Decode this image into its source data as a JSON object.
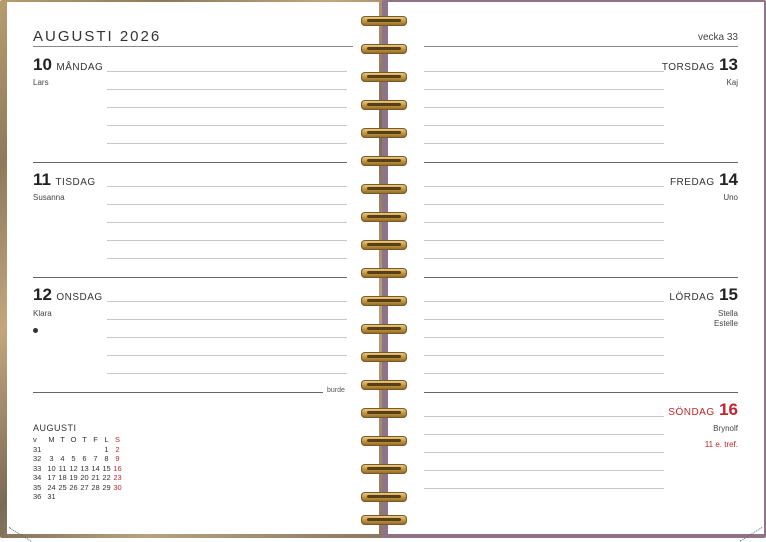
{
  "left_page": {
    "month_title": "AUGUSTI 2026",
    "days": [
      {
        "num": "10",
        "name": "MÅNDAG",
        "name_day": "Lars"
      },
      {
        "num": "11",
        "name": "TISDAG",
        "name_day": "Susanna"
      },
      {
        "num": "12",
        "name": "ONSDAG",
        "name_day": "Klara"
      }
    ],
    "brand": "burde",
    "mini_calendar": {
      "title": "AUGUSTI",
      "headers": [
        "v",
        "M",
        "T",
        "O",
        "T",
        "F",
        "L",
        "S"
      ],
      "rows": [
        [
          "31",
          "",
          "",
          "",
          "",
          "",
          "1",
          "2"
        ],
        [
          "32",
          "3",
          "4",
          "5",
          "6",
          "7",
          "8",
          "9"
        ],
        [
          "33",
          "10",
          "11",
          "12",
          "13",
          "14",
          "15",
          "16"
        ],
        [
          "34",
          "17",
          "18",
          "19",
          "20",
          "21",
          "22",
          "23"
        ],
        [
          "35",
          "24",
          "25",
          "26",
          "27",
          "28",
          "29",
          "30"
        ],
        [
          "36",
          "31",
          "",
          "",
          "",
          "",
          "",
          ""
        ]
      ]
    }
  },
  "right_page": {
    "week_label": "vecka 33",
    "days": [
      {
        "num": "13",
        "name": "TORSDAG",
        "name_day": "Kaj"
      },
      {
        "num": "14",
        "name": "FREDAG",
        "name_day": "Uno"
      },
      {
        "num": "15",
        "name": "LÖRDAG",
        "name_day_1": "Stella",
        "name_day_2": "Estelle"
      },
      {
        "num": "16",
        "name": "SÖNDAG",
        "name_day": "Brynolf",
        "note": "11 e. tref."
      }
    ]
  },
  "colors": {
    "sunday_red": "#c0262e",
    "cover_right": "#8f7488",
    "spiral_gold": "#c89d4c"
  }
}
